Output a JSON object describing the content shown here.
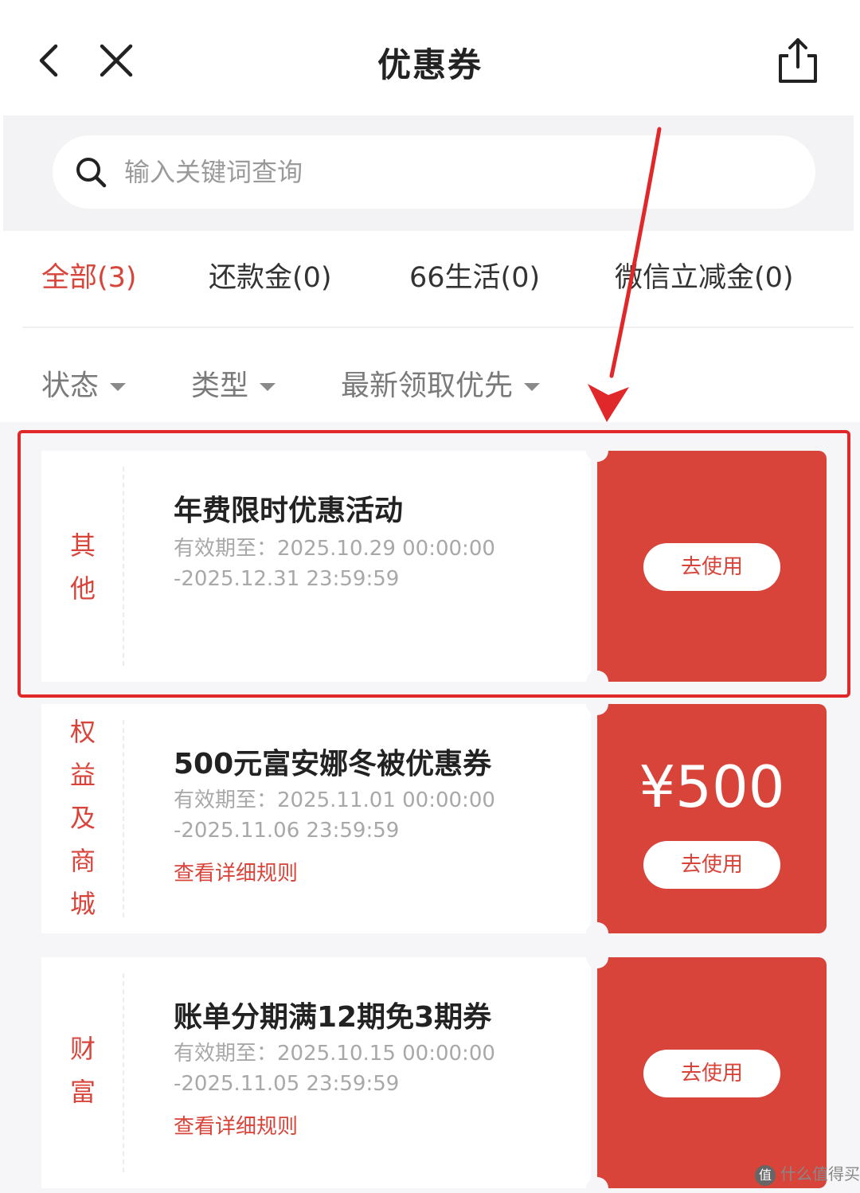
{
  "header": {
    "title": "优惠券",
    "back_icon": "chevron-left-icon",
    "close_icon": "close-icon",
    "share_icon": "share-icon"
  },
  "search": {
    "placeholder": "输入关键词查询",
    "value": ""
  },
  "tabs": [
    {
      "label": "全部(3)",
      "active": true
    },
    {
      "label": "还款金(0)",
      "active": false
    },
    {
      "label": "66生活(0)",
      "active": false
    },
    {
      "label": "微信立减金(0)",
      "active": false
    }
  ],
  "filters": [
    {
      "label": "状态"
    },
    {
      "label": "类型"
    },
    {
      "label": "最新领取优先"
    }
  ],
  "coupons": [
    {
      "category": "其他",
      "title": "年费限时优惠活动",
      "valid_line1": "有效期至：2025.10.29 00:00:00",
      "valid_line2": "-2025.12.31 23:59:59",
      "rules": "",
      "amount": "",
      "button": "去使用"
    },
    {
      "category": "权益及商城",
      "title": "500元富安娜冬被优惠券",
      "valid_line1": "有效期至：2025.11.01 00:00:00",
      "valid_line2": "-2025.11.06 23:59:59",
      "rules": "查看详细规则",
      "amount": "¥500",
      "button": "去使用"
    },
    {
      "category": "财富",
      "title": "账单分期满12期免3期券",
      "valid_line1": "有效期至：2025.10.15 00:00:00",
      "valid_line2": "-2025.11.05 23:59:59",
      "rules": "查看详细规则",
      "amount": "",
      "button": "去使用"
    }
  ],
  "watermark": {
    "logo": "值",
    "text": "什么值得买"
  },
  "colors": {
    "accent": "#d9443a",
    "annotation": "#e0282a"
  }
}
